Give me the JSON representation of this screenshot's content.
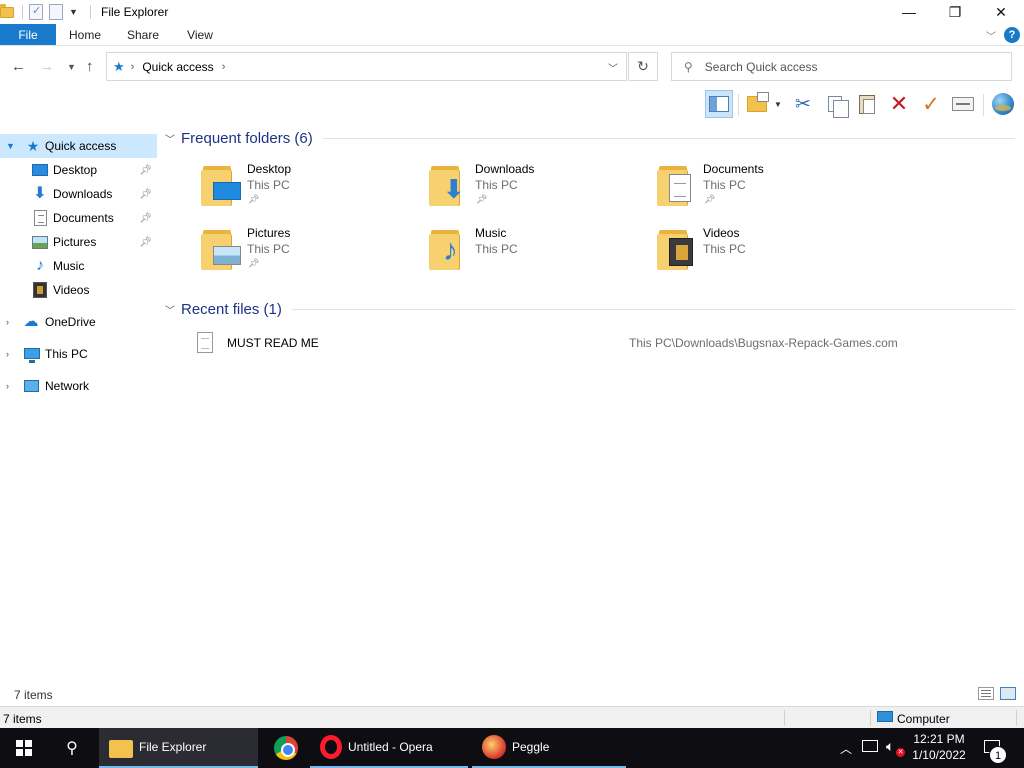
{
  "window": {
    "title": "File Explorer",
    "minimize": "—",
    "restore": "❐",
    "close": "✕"
  },
  "ribbon": {
    "tabs": [
      "File",
      "Home",
      "Share",
      "View"
    ],
    "help": "?"
  },
  "address": {
    "location": "Quick access",
    "search_placeholder": "Search Quick access"
  },
  "toolbar": {
    "icons": [
      "preview-pane-icon",
      "new-folder-icon",
      "cut-icon",
      "copy-icon",
      "paste-icon",
      "delete-icon",
      "checkmark-icon",
      "rename-icon",
      "globe-icon"
    ]
  },
  "navigation": {
    "quick_access": "Quick access",
    "pinned": [
      "Desktop",
      "Downloads",
      "Documents",
      "Pictures"
    ],
    "unpinned": [
      "Music",
      "Videos"
    ],
    "onedrive": "OneDrive",
    "this_pc": "This PC",
    "network": "Network"
  },
  "content": {
    "frequent_header": "Frequent folders (6)",
    "folders": [
      {
        "name": "Desktop",
        "location": "This PC"
      },
      {
        "name": "Downloads",
        "location": "This PC"
      },
      {
        "name": "Documents",
        "location": "This PC"
      },
      {
        "name": "Pictures",
        "location": "This PC"
      },
      {
        "name": "Music",
        "location": "This PC"
      },
      {
        "name": "Videos",
        "location": "This PC"
      }
    ],
    "recent_header": "Recent files (1)",
    "recent_files": [
      {
        "name": "MUST READ ME",
        "path": "This PC\\Downloads\\Bugsnax-Repack-Games.com"
      }
    ]
  },
  "status": {
    "items": "7 items",
    "outer_items": "7 items",
    "computer": "Computer"
  },
  "taskbar": {
    "items": [
      "File Explorer",
      "Untitled - Opera",
      "Peggle"
    ],
    "time": "12:21 PM",
    "date": "1/10/2022",
    "notifications": "1"
  },
  "colors": {
    "accent": "#1979ca",
    "selection": "#cce8ff",
    "group_header": "#1e3287",
    "taskbar": "#0e0e12"
  }
}
